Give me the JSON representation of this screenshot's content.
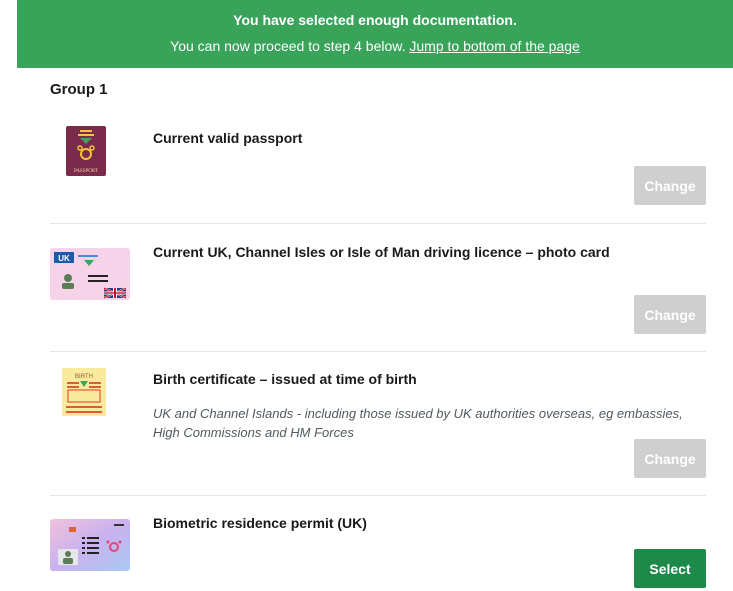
{
  "banner": {
    "title": "You have selected enough documentation.",
    "text": "You can now proceed to step 4 below.",
    "link": "Jump to bottom of the page",
    "color": "#3aa35a"
  },
  "group": {
    "title": "Group 1"
  },
  "documents": [
    {
      "icon": "passport-icon",
      "title": "Current valid passport",
      "description": "",
      "button": "Change",
      "state": "selected"
    },
    {
      "icon": "driving-licence-icon",
      "title": "Current UK, Channel Isles or Isle of Man driving licence – photo card",
      "description": "",
      "button": "Change",
      "state": "selected"
    },
    {
      "icon": "birth-certificate-icon",
      "title": "Birth certificate – issued at time of birth",
      "description": "UK and Channel Islands - including those issued by UK authorities overseas, eg embassies, High Commissions and HM Forces",
      "button": "Change",
      "state": "selected"
    },
    {
      "icon": "residence-permit-icon",
      "title": "Biometric residence permit (UK)",
      "description": "",
      "button": "Select",
      "state": "available"
    }
  ],
  "icon_text": {
    "passport": "PASSPORT",
    "uk": "UK",
    "birth": "BIRTH"
  },
  "colors": {
    "select_button": "#1e8a4a",
    "change_button": "#cfcfcf"
  }
}
